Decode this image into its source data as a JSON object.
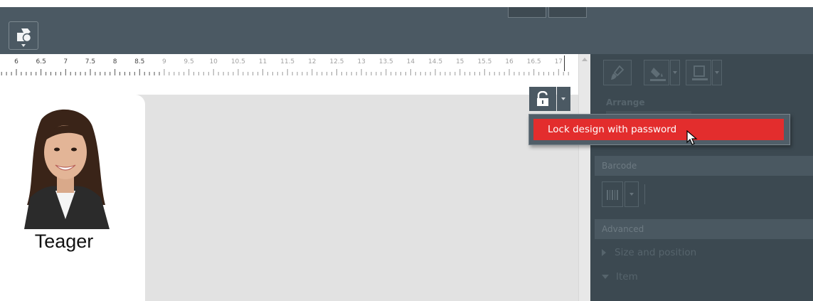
{
  "ruler": {
    "labels": [
      "6",
      "6.5",
      "7",
      "7.5",
      "8",
      "8.5",
      "9",
      "9.5",
      "10",
      "10.5",
      "11",
      "11.5",
      "12",
      "12.5",
      "13",
      "13.5",
      "14",
      "14.5",
      "15",
      "15.5",
      "16",
      "16.5",
      "17"
    ]
  },
  "card": {
    "name": "Teager"
  },
  "lock_menu": {
    "item_label": "Lock design with password"
  },
  "panel": {
    "arrange_header": "Arrange",
    "barcode_header": "Barcode",
    "advanced_header": "Advanced",
    "size_and_position": "Size and position",
    "item": "Item"
  },
  "colors": {
    "toolbar_bg": "#4b5963",
    "menu_highlight": "#e32d2d",
    "canvas_bg": "#e2e2e2",
    "panel_dimmed_bg": "#3c4951"
  },
  "icons": [
    "app-menu-icon",
    "unlock-icon",
    "chevron-down-icon",
    "brush-icon",
    "fill-bucket-icon",
    "border-style-icon",
    "barcode-icon",
    "cursor-icon"
  ]
}
